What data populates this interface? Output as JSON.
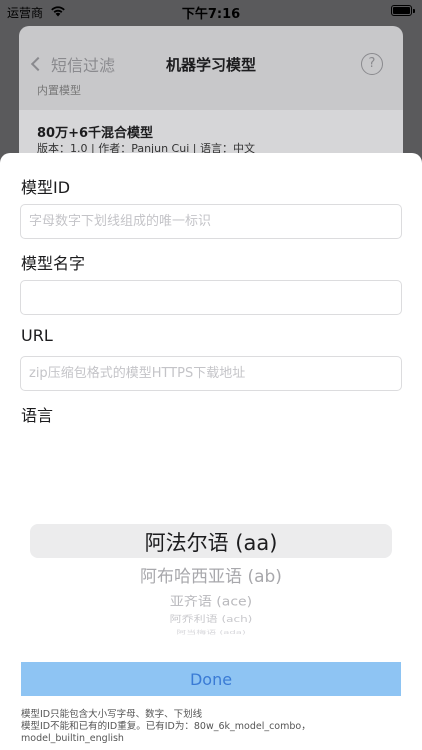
{
  "status_bar": {
    "carrier": "运营商",
    "time": "下午7:16",
    "battery_level": 1.0
  },
  "background_screen": {
    "back_label": "短信过滤",
    "title": "机器学习模型",
    "help_icon": "question-circle-icon",
    "help_glyph": "?",
    "section_header": "内置模型",
    "model_row": {
      "name": "80万+6千混合模型",
      "meta": "版本：1.0 | 作者：Panjun Cui | 语言：中文"
    }
  },
  "form": {
    "model_id": {
      "label": "模型ID",
      "value": "",
      "placeholder": "字母数字下划线组成的唯一标识"
    },
    "model_name": {
      "label": "模型名字",
      "value": "",
      "placeholder": ""
    },
    "url": {
      "label": "URL",
      "value": "",
      "placeholder": "zip压缩包格式的模型HTTPS下载地址"
    },
    "language": {
      "label": "语言",
      "options": [
        "阿法尔语 (aa)",
        "阿布哈西亚语 (ab)",
        "亚齐语 (ace)",
        "阿乔利语 (ach)",
        "阿当梅语 (ada)"
      ],
      "selected": "阿法尔语 (aa)"
    }
  },
  "done_label": "Done",
  "hint_lines": [
    "模型ID只能包含大小写字母、数字、下划线",
    "模型ID不能和已有的ID重复。已有ID为：80w_6k_model_combo，",
    "model_builtin_english"
  ]
}
